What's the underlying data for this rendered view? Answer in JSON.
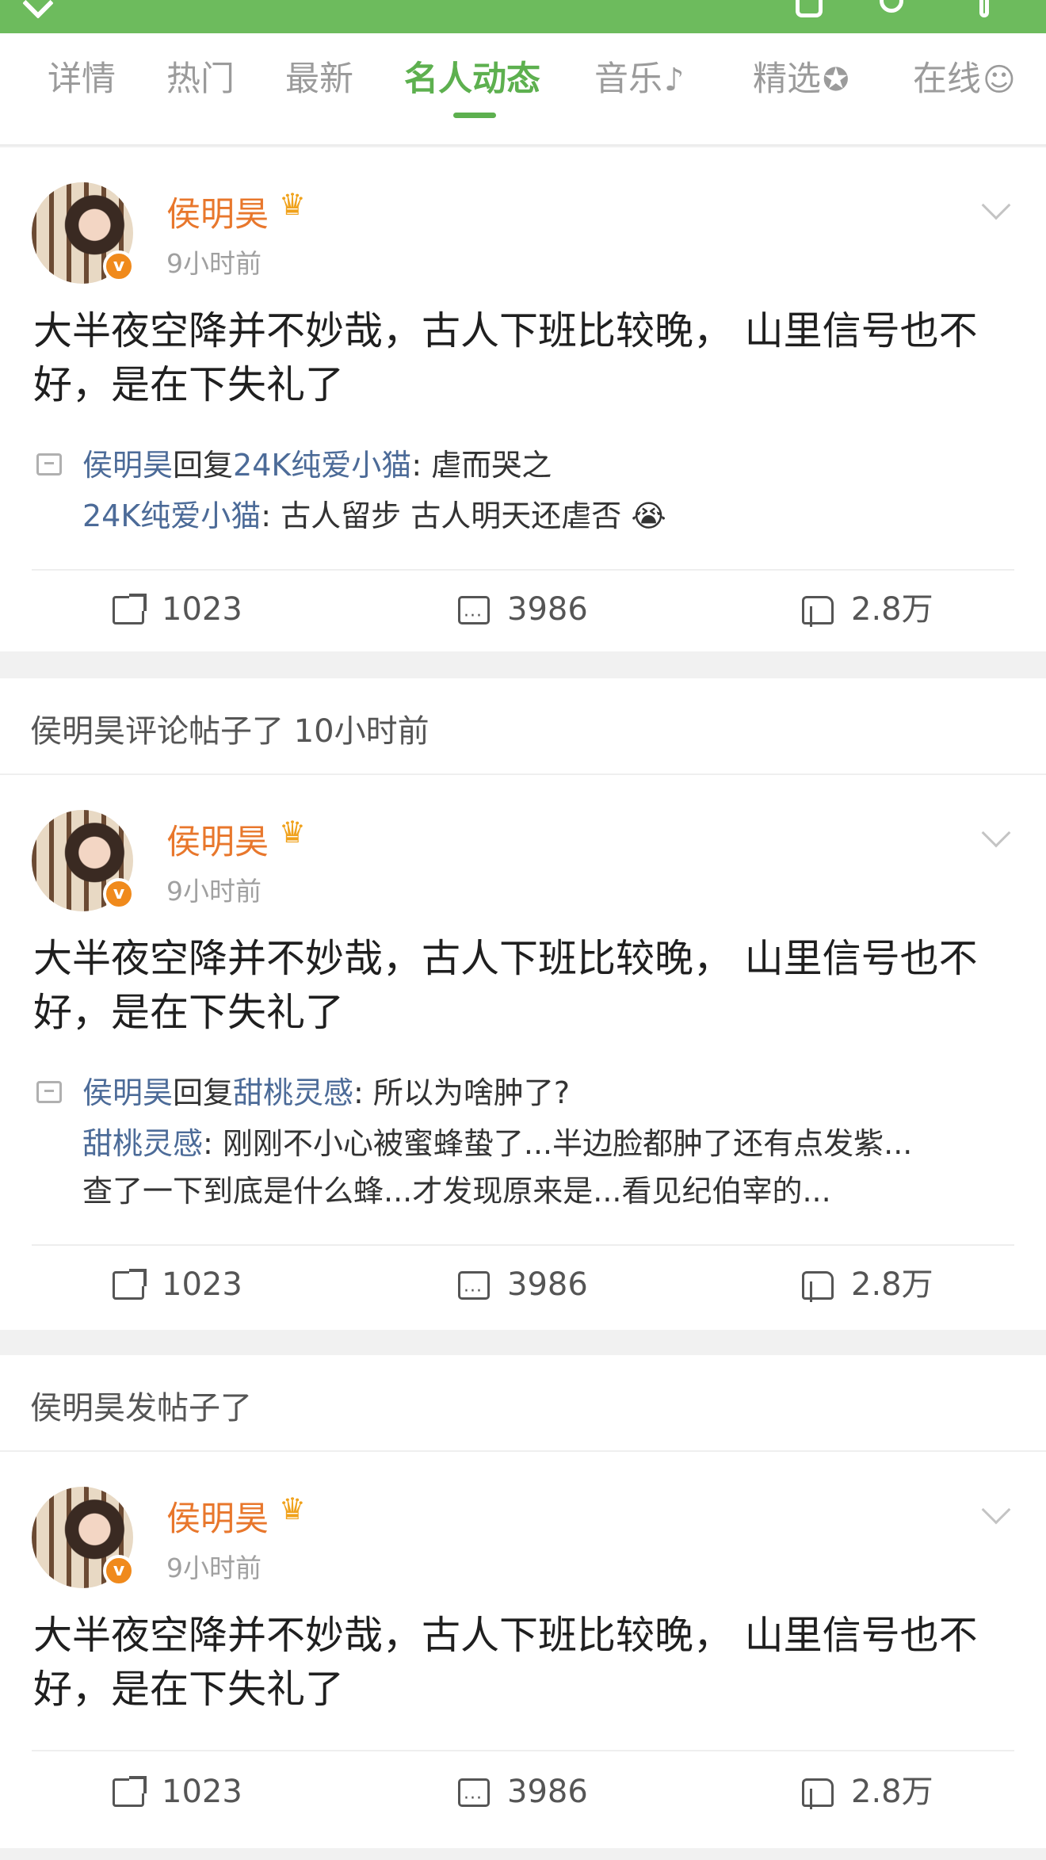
{
  "tabs": [
    {
      "label": "详情",
      "glyph": ""
    },
    {
      "label": "热门",
      "glyph": ""
    },
    {
      "label": "最新",
      "glyph": ""
    },
    {
      "label": "名人动态",
      "glyph": ""
    },
    {
      "label": "音乐",
      "glyph": "♪"
    },
    {
      "label": "精选",
      "glyph": "✪"
    },
    {
      "label": "在线",
      "glyph": "☺"
    }
  ],
  "active_tab": "名人动态",
  "colors": {
    "accent": "#5db04f",
    "username": "#e8772c",
    "link": "#4c6b98"
  },
  "posts": [
    {
      "author": "侯明昊",
      "time": "9小时前",
      "text": "大半夜空降并不妙哉，古人下班比较晚， 山里信号也不好，是在下失礼了",
      "replies": [
        {
          "user": "侯明昊",
          "mid": "回复",
          "target": "24K纯爱小猫",
          "text": ": 虐而哭之"
        },
        {
          "user": "24K纯爱小猫",
          "text": ": 古人留步 古人明天还虐否 😭"
        }
      ],
      "share": "1023",
      "comments": "3986",
      "likes": "2.8万"
    },
    {
      "section": "侯明昊评论帖子了 10小时前",
      "author": "侯明昊",
      "time": "9小时前",
      "text": "大半夜空降并不妙哉，古人下班比较晚， 山里信号也不好，是在下失礼了",
      "replies": [
        {
          "user": "侯明昊",
          "mid": "回复",
          "target": "甜桃灵感",
          "text": ": 所以为啥肿了?"
        },
        {
          "user": "甜桃灵感",
          "text": ": 刚刚不小心被蜜蜂蛰了...半边脸都肿了还有点发紫..."
        },
        {
          "text": "查了一下到底是什么蜂...才发现原来是...看见纪伯宰的..."
        }
      ],
      "share": "1023",
      "comments": "3986",
      "likes": "2.8万"
    },
    {
      "section": "侯明昊发帖子了",
      "author": "侯明昊",
      "time": "9小时前",
      "text": "大半夜空降并不妙哉，古人下班比较晚， 山里信号也不好，是在下失礼了",
      "share": "1023",
      "comments": "3986",
      "likes": "2.8万"
    }
  ]
}
